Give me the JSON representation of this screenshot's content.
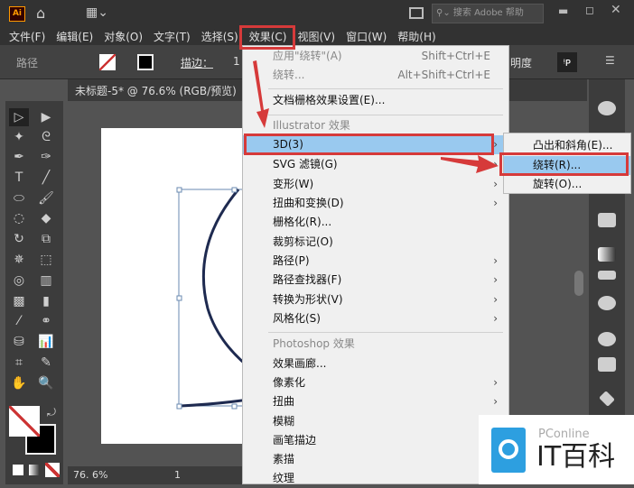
{
  "app": {
    "logo": "Ai",
    "search_placeholder": "搜索 Adobe 帮助"
  },
  "menubar": [
    "文件(F)",
    "编辑(E)",
    "对象(O)",
    "文字(T)",
    "选择(S)",
    "效果(C)",
    "视图(V)",
    "窗口(W)",
    "帮助(H)"
  ],
  "control": {
    "type": "路径",
    "stroke_label": "描边：",
    "stroke_value": "1",
    "opacity_label": "明度"
  },
  "document": {
    "tab": "未标题-5* @ 76.6% (RGB/预览)",
    "zoom": "76. 6%",
    "page": "1"
  },
  "effect_menu": {
    "items": [
      {
        "label": "应用\"绕转\"(A)",
        "shortcut": "Shift+Ctrl+E",
        "disabled": true
      },
      {
        "label": "绕转...",
        "shortcut": "Alt+Shift+Ctrl+E",
        "disabled": true
      },
      {
        "label": "文档栅格效果设置(E)..."
      },
      {
        "label": "Illustrator 效果",
        "header": true
      },
      {
        "label": "3D(3)",
        "sub": true,
        "highlight": true
      },
      {
        "label": "SVG 滤镜(G)",
        "sub": true
      },
      {
        "label": "变形(W)",
        "sub": true
      },
      {
        "label": "扭曲和变换(D)",
        "sub": true
      },
      {
        "label": "栅格化(R)..."
      },
      {
        "label": "裁剪标记(O)"
      },
      {
        "label": "路径(P)",
        "sub": true
      },
      {
        "label": "路径查找器(F)",
        "sub": true
      },
      {
        "label": "转换为形状(V)",
        "sub": true
      },
      {
        "label": "风格化(S)",
        "sub": true
      },
      {
        "label": "Photoshop 效果",
        "header": true
      },
      {
        "label": "效果画廊..."
      },
      {
        "label": "像素化",
        "sub": true
      },
      {
        "label": "扭曲",
        "sub": true
      },
      {
        "label": "模糊",
        "sub": true
      },
      {
        "label": "画笔描边",
        "sub": true
      },
      {
        "label": "素描",
        "sub": true
      },
      {
        "label": "纹理"
      }
    ]
  },
  "submenu_3d": [
    "凸出和斜角(E)...",
    "绕转(R)...",
    "旋转(O)..."
  ],
  "watermark": {
    "brand": "PConline",
    "name": "IT百科"
  },
  "colors": {
    "highlight": "#99c9ef",
    "annotation": "#d63a3a"
  }
}
